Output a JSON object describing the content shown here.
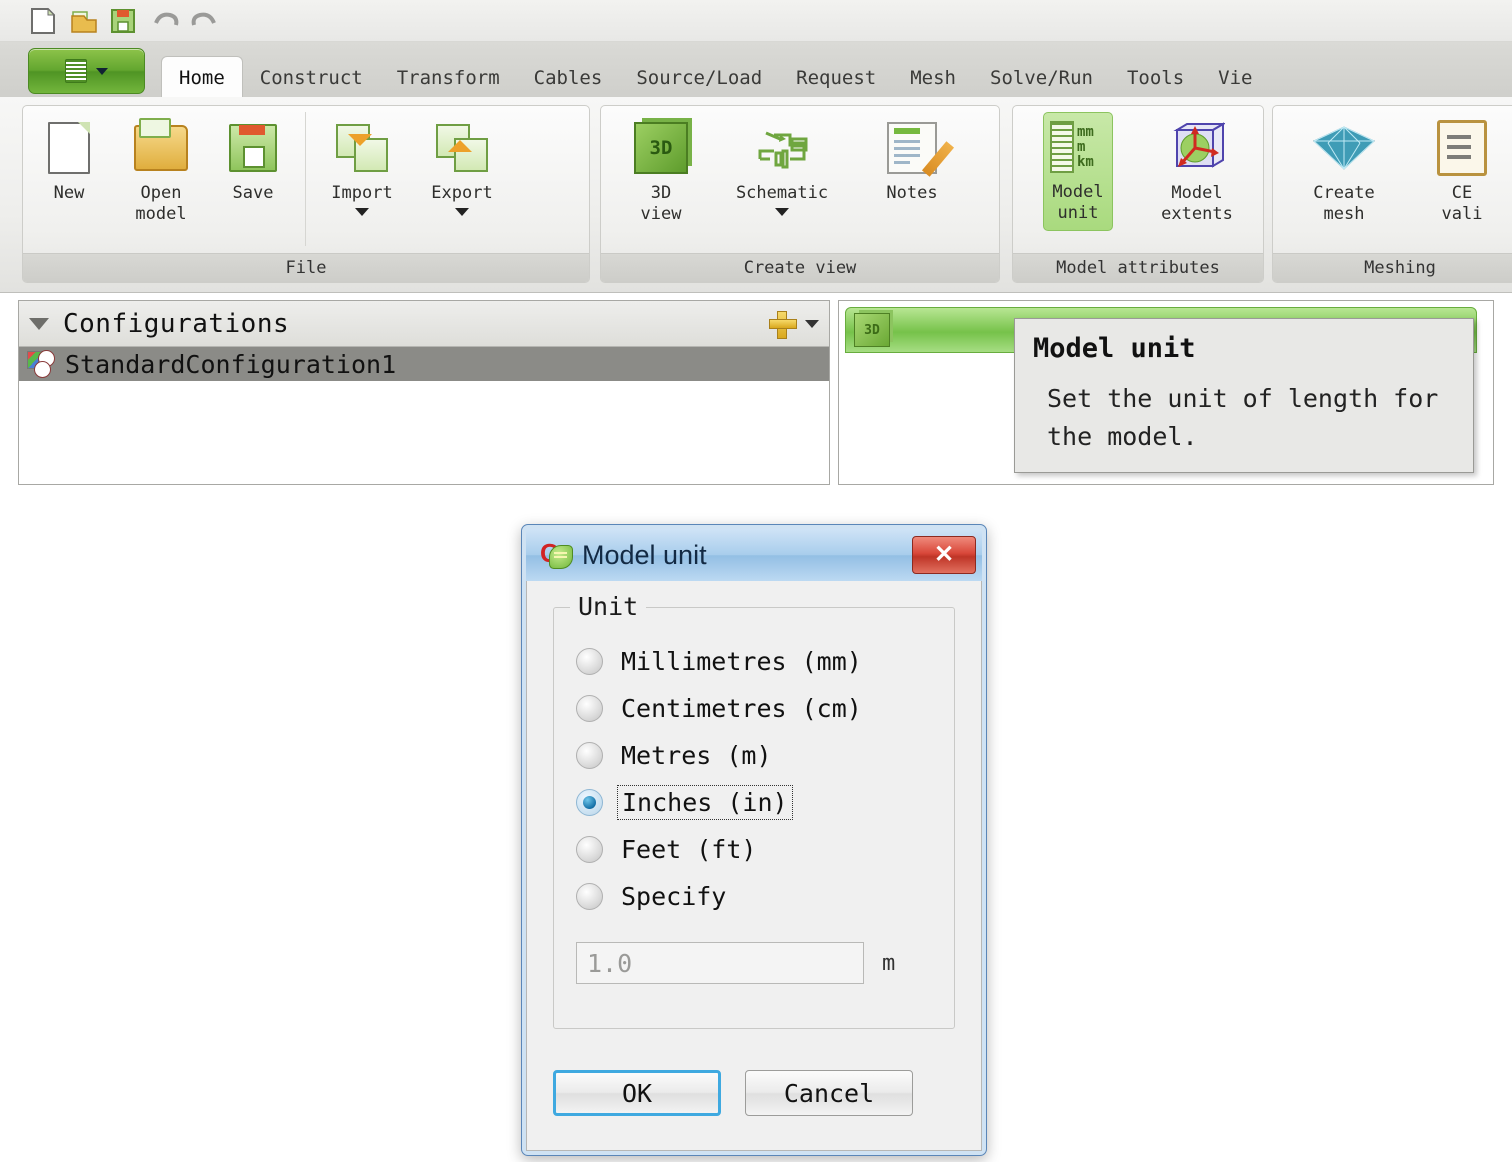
{
  "quick_access": {
    "items": [
      {
        "name": "new-icon",
        "label": "New"
      },
      {
        "name": "open-icon",
        "label": "Open"
      },
      {
        "name": "save-icon",
        "label": "Save"
      },
      {
        "name": "undo-icon",
        "label": "Undo"
      },
      {
        "name": "redo-icon",
        "label": "Redo"
      }
    ]
  },
  "app_button": {
    "label": "",
    "icon": "application-menu-icon"
  },
  "ribbon": {
    "tabs": [
      {
        "label": "Home",
        "active": true
      },
      {
        "label": "Construct",
        "active": false
      },
      {
        "label": "Transform",
        "active": false
      },
      {
        "label": "Cables",
        "active": false
      },
      {
        "label": "Source/Load",
        "active": false
      },
      {
        "label": "Request",
        "active": false
      },
      {
        "label": "Mesh",
        "active": false
      },
      {
        "label": "Solve/Run",
        "active": false
      },
      {
        "label": "Tools",
        "active": false
      },
      {
        "label": "Vie",
        "active": false
      }
    ],
    "groups": [
      {
        "title": "File",
        "buttons": [
          {
            "label": "New",
            "icon": "new-document-icon",
            "caret": false
          },
          {
            "label": "Open\nmodel",
            "line1": "Open",
            "line2": "model",
            "icon": "open-folder-icon",
            "caret": false
          },
          {
            "label": "Save",
            "icon": "save-disk-icon",
            "caret": false
          },
          {
            "label": "Import",
            "icon": "import-icon",
            "caret": true
          },
          {
            "label": "Export",
            "icon": "export-icon",
            "caret": true
          }
        ]
      },
      {
        "title": "Create view",
        "buttons": [
          {
            "label": "3D view",
            "line1": "3D",
            "line2": "view",
            "icon": "cube-3d-icon",
            "caret": false
          },
          {
            "label": "Schematic",
            "icon": "schematic-icon",
            "caret": true
          },
          {
            "label": "Notes",
            "icon": "notes-icon",
            "caret": false
          }
        ]
      },
      {
        "title": "Model attributes",
        "buttons": [
          {
            "label": "Model unit",
            "line1": "Model",
            "line2": "unit",
            "icon": "ruler-unit-icon",
            "caret": false,
            "selected": true,
            "icon_text": [
              "mm",
              "m",
              "km"
            ]
          },
          {
            "label": "Model extents",
            "line1": "Model",
            "line2": "extents",
            "icon": "model-extents-icon",
            "caret": false
          }
        ]
      },
      {
        "title": "Meshing",
        "buttons": [
          {
            "label": "Create mesh",
            "line1": "Create",
            "line2": "mesh",
            "icon": "create-mesh-icon",
            "caret": false
          },
          {
            "label": "CEM validate",
            "line1": "CE",
            "line2": "vali",
            "icon": "cem-validate-icon",
            "caret": false
          }
        ]
      }
    ]
  },
  "configurations_panel": {
    "title": "Configurations",
    "collapse_icon": "chevron-down-icon",
    "add_icon": "plus-icon",
    "add_dropdown_icon": "chevron-down-icon",
    "rows": [
      {
        "label": "StandardConfiguration1",
        "icon": "configuration-icon",
        "selected": true
      }
    ]
  },
  "view_tab": {
    "icon": "cube-3d-icon",
    "label": ""
  },
  "tooltip": {
    "title": "Model unit",
    "body": "Set the unit of length for the model."
  },
  "dialog": {
    "title": "Model unit",
    "icon": "feko-cadfeko-icon",
    "close_icon": "close-icon",
    "close_label": "✕",
    "group_legend": "Unit",
    "options": [
      {
        "label": "Millimetres (mm)",
        "checked": false,
        "focused": false
      },
      {
        "label": "Centimetres (cm)",
        "checked": false,
        "focused": false
      },
      {
        "label": "Metres (m)",
        "checked": false,
        "focused": false
      },
      {
        "label": "Inches (in)",
        "checked": true,
        "focused": true
      },
      {
        "label": "Feet (ft)",
        "checked": false,
        "focused": false
      },
      {
        "label": "Specify",
        "checked": false,
        "focused": false
      }
    ],
    "specify_value": "1.0",
    "specify_unit": "m",
    "buttons": [
      {
        "label": "OK",
        "default": true
      },
      {
        "label": "Cancel",
        "default": false
      }
    ]
  },
  "colors": {
    "accent_green": "#63a62f",
    "selection_grey": "#8b8b87",
    "dialog_blue": "#a8cdec",
    "close_red": "#d9483a",
    "default_button_border": "#3fa9e0"
  }
}
